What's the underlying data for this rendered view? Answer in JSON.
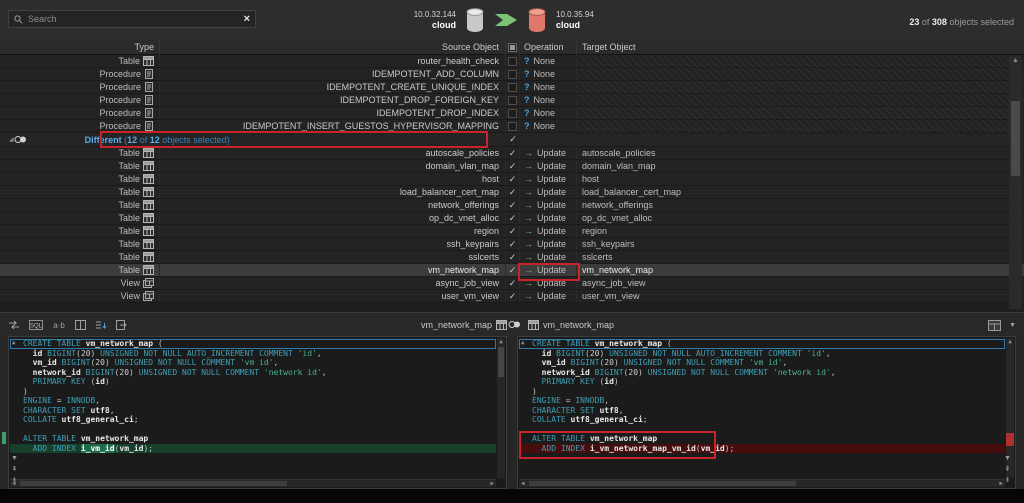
{
  "colors": {
    "annotation_red": "#c9242b",
    "update_green": "#6abf69",
    "none_question_blue": "#4f9fd8",
    "group_text_blue": "#4aa0dc",
    "source_db_icon": "#c9c9c9",
    "target_db_icon": "#e0776a",
    "transfer_arrow_green": "#7cc576",
    "diff_added_bg": "#16402c",
    "diff_removed_bg": "#470d0d",
    "sql_keyword": "#3f9fb5",
    "sql_string": "#4cb193"
  },
  "topbar": {
    "search_placeholder": "Search",
    "clear_glyph": "×",
    "source_connection": {
      "host": "10.0.32.144",
      "database": "cloud"
    },
    "target_connection": {
      "host": "10.0.35.94",
      "database": "cloud"
    },
    "selection": {
      "selected_count": "23",
      "of_word": "of",
      "total_count": "308",
      "suffix": "objects selected"
    }
  },
  "grid": {
    "columns": {
      "type": "Type",
      "source": "Source Object",
      "operation": "Operation",
      "target": "Target Object"
    },
    "only_source_rows": [
      {
        "type": "Table",
        "icon": "table",
        "source": "router_health_check",
        "checked": false,
        "operation": "None",
        "target": ""
      },
      {
        "type": "Procedure",
        "icon": "procedure",
        "source": "IDEMPOTENT_ADD_COLUMN",
        "checked": false,
        "operation": "None",
        "target": ""
      },
      {
        "type": "Procedure",
        "icon": "procedure",
        "source": "IDEMPOTENT_CREATE_UNIQUE_INDEX",
        "checked": false,
        "operation": "None",
        "target": ""
      },
      {
        "type": "Procedure",
        "icon": "procedure",
        "source": "IDEMPOTENT_DROP_FOREIGN_KEY",
        "checked": false,
        "operation": "None",
        "target": ""
      },
      {
        "type": "Procedure",
        "icon": "procedure",
        "source": "IDEMPOTENT_DROP_INDEX",
        "checked": false,
        "operation": "None",
        "target": ""
      },
      {
        "type": "Procedure",
        "icon": "procedure",
        "source": "IDEMPOTENT_INSERT_GUESTOS_HYPERVISOR_MAPPING",
        "checked": false,
        "operation": "None",
        "target": ""
      }
    ],
    "group": {
      "name": "Different",
      "open_paren": "(",
      "selected_count": "12",
      "of_word": "of",
      "total_count": "12",
      "suffix": "objects selected)"
    },
    "different_rows": [
      {
        "type": "Table",
        "icon": "table",
        "source": "autoscale_policies",
        "checked": true,
        "operation": "Update",
        "target": "autoscale_policies"
      },
      {
        "type": "Table",
        "icon": "table",
        "source": "domain_vlan_map",
        "checked": true,
        "operation": "Update",
        "target": "domain_vlan_map"
      },
      {
        "type": "Table",
        "icon": "table",
        "source": "host",
        "checked": true,
        "operation": "Update",
        "target": "host"
      },
      {
        "type": "Table",
        "icon": "table",
        "source": "load_balancer_cert_map",
        "checked": true,
        "operation": "Update",
        "target": "load_balancer_cert_map"
      },
      {
        "type": "Table",
        "icon": "table",
        "source": "network_offerings",
        "checked": true,
        "operation": "Update",
        "target": "network_offerings"
      },
      {
        "type": "Table",
        "icon": "table",
        "source": "op_dc_vnet_alloc",
        "checked": true,
        "operation": "Update",
        "target": "op_dc_vnet_alloc"
      },
      {
        "type": "Table",
        "icon": "table",
        "source": "region",
        "checked": true,
        "operation": "Update",
        "target": "region"
      },
      {
        "type": "Table",
        "icon": "table",
        "source": "ssh_keypairs",
        "checked": true,
        "operation": "Update",
        "target": "ssh_keypairs"
      },
      {
        "type": "Table",
        "icon": "table",
        "source": "sslcerts",
        "checked": true,
        "operation": "Update",
        "target": "sslcerts"
      },
      {
        "type": "Table",
        "icon": "table",
        "source": "vm_network_map",
        "checked": true,
        "operation": "Update",
        "target": "vm_network_map",
        "selected": true
      },
      {
        "type": "View",
        "icon": "view",
        "source": "async_job_view",
        "checked": true,
        "operation": "Update",
        "target": "async_job_view"
      },
      {
        "type": "View",
        "icon": "view",
        "source": "user_vm_view",
        "checked": true,
        "operation": "Update",
        "target": "user_vm_view"
      }
    ]
  },
  "editor": {
    "left_title": "vm_network_map",
    "right_title": "vm_network_map",
    "left_lines": [
      {
        "hl": "cur",
        "t": [
          [
            "k",
            "CREATE TABLE"
          ],
          [
            "p",
            " "
          ],
          [
            "i",
            "vm_network_map"
          ],
          [
            "p",
            " ("
          ]
        ]
      },
      {
        "t": [
          [
            "p",
            "  "
          ],
          [
            "i",
            "id"
          ],
          [
            "p",
            " "
          ],
          [
            "k",
            "BIGINT"
          ],
          [
            "p",
            "("
          ],
          [
            "n",
            "20"
          ],
          [
            "p",
            ") "
          ],
          [
            "k",
            "UNSIGNED NOT NULL AUTO_INCREMENT COMMENT"
          ],
          [
            "p",
            " "
          ],
          [
            "s",
            "'id'"
          ],
          [
            "p",
            ","
          ]
        ]
      },
      {
        "t": [
          [
            "p",
            "  "
          ],
          [
            "i",
            "vm_id"
          ],
          [
            "p",
            " "
          ],
          [
            "k",
            "BIGINT"
          ],
          [
            "p",
            "("
          ],
          [
            "n",
            "20"
          ],
          [
            "p",
            ") "
          ],
          [
            "k",
            "UNSIGNED NOT NULL COMMENT"
          ],
          [
            "p",
            " "
          ],
          [
            "s",
            "'vm id'"
          ],
          [
            "p",
            ","
          ]
        ]
      },
      {
        "t": [
          [
            "p",
            "  "
          ],
          [
            "i",
            "network_id"
          ],
          [
            "p",
            " "
          ],
          [
            "k",
            "BIGINT"
          ],
          [
            "p",
            "("
          ],
          [
            "n",
            "20"
          ],
          [
            "p",
            ") "
          ],
          [
            "k",
            "UNSIGNED NOT NULL COMMENT"
          ],
          [
            "p",
            " "
          ],
          [
            "s",
            "'network id'"
          ],
          [
            "p",
            ","
          ]
        ]
      },
      {
        "t": [
          [
            "p",
            "  "
          ],
          [
            "k",
            "PRIMARY KEY"
          ],
          [
            "p",
            " ("
          ],
          [
            "i",
            "id"
          ],
          [
            "p",
            ")"
          ]
        ]
      },
      {
        "t": [
          [
            "p",
            ")"
          ]
        ]
      },
      {
        "t": [
          [
            "k",
            "ENGINE"
          ],
          [
            "p",
            " = "
          ],
          [
            "k",
            "INNODB"
          ],
          [
            "p",
            ","
          ]
        ]
      },
      {
        "t": [
          [
            "k",
            "CHARACTER SET"
          ],
          [
            "p",
            " "
          ],
          [
            "i",
            "utf8"
          ],
          [
            "p",
            ","
          ]
        ]
      },
      {
        "t": [
          [
            "k",
            "COLLATE"
          ],
          [
            "p",
            " "
          ],
          [
            "i",
            "utf8_general_ci"
          ],
          [
            "p",
            ";"
          ]
        ]
      },
      {
        "t": []
      },
      {
        "t": [
          [
            "k",
            "ALTER TABLE"
          ],
          [
            "p",
            " "
          ],
          [
            "i",
            "vm_network_map"
          ]
        ]
      },
      {
        "hl": "green",
        "t": [
          [
            "p",
            "  "
          ],
          [
            "k",
            "ADD INDEX"
          ],
          [
            "p",
            " "
          ],
          [
            "hi",
            "i_vm_id"
          ],
          [
            "p",
            "("
          ],
          [
            "i",
            "vm_id"
          ],
          [
            "p",
            ");"
          ]
        ]
      }
    ],
    "right_lines": [
      {
        "hl": "cur",
        "t": [
          [
            "k",
            "CREATE TABLE"
          ],
          [
            "p",
            " "
          ],
          [
            "i",
            "vm_network_map"
          ],
          [
            "p",
            " ("
          ]
        ]
      },
      {
        "t": [
          [
            "p",
            "  "
          ],
          [
            "i",
            "id"
          ],
          [
            "p",
            " "
          ],
          [
            "k",
            "BIGINT"
          ],
          [
            "p",
            "("
          ],
          [
            "n",
            "20"
          ],
          [
            "p",
            ") "
          ],
          [
            "k",
            "UNSIGNED NOT NULL AUTO_INCREMENT COMMENT"
          ],
          [
            "p",
            " "
          ],
          [
            "s",
            "'id'"
          ],
          [
            "p",
            ","
          ]
        ]
      },
      {
        "t": [
          [
            "p",
            "  "
          ],
          [
            "i",
            "vm_id"
          ],
          [
            "p",
            " "
          ],
          [
            "k",
            "BIGINT"
          ],
          [
            "p",
            "("
          ],
          [
            "n",
            "20"
          ],
          [
            "p",
            ") "
          ],
          [
            "k",
            "UNSIGNED NOT NULL COMMENT"
          ],
          [
            "p",
            " "
          ],
          [
            "s",
            "'vm id'"
          ],
          [
            "p",
            ","
          ]
        ]
      },
      {
        "t": [
          [
            "p",
            "  "
          ],
          [
            "i",
            "network_id"
          ],
          [
            "p",
            " "
          ],
          [
            "k",
            "BIGINT"
          ],
          [
            "p",
            "("
          ],
          [
            "n",
            "20"
          ],
          [
            "p",
            ") "
          ],
          [
            "k",
            "UNSIGNED NOT NULL COMMENT"
          ],
          [
            "p",
            " "
          ],
          [
            "s",
            "'network id'"
          ],
          [
            "p",
            ","
          ]
        ]
      },
      {
        "t": [
          [
            "p",
            "  "
          ],
          [
            "k",
            "PRIMARY KEY"
          ],
          [
            "p",
            " ("
          ],
          [
            "i",
            "id"
          ],
          [
            "p",
            ")"
          ]
        ]
      },
      {
        "t": [
          [
            "p",
            ")"
          ]
        ]
      },
      {
        "t": [
          [
            "k",
            "ENGINE"
          ],
          [
            "p",
            " = "
          ],
          [
            "k",
            "INNODB"
          ],
          [
            "p",
            ","
          ]
        ]
      },
      {
        "t": [
          [
            "k",
            "CHARACTER SET"
          ],
          [
            "p",
            " "
          ],
          [
            "i",
            "utf8"
          ],
          [
            "p",
            ","
          ]
        ]
      },
      {
        "t": [
          [
            "k",
            "COLLATE"
          ],
          [
            "p",
            " "
          ],
          [
            "i",
            "utf8_general_ci"
          ],
          [
            "p",
            ";"
          ]
        ]
      },
      {
        "t": []
      },
      {
        "t": [
          [
            "k",
            "ALTER TABLE"
          ],
          [
            "p",
            " "
          ],
          [
            "i",
            "vm_network_map"
          ]
        ]
      },
      {
        "hl": "red",
        "t": [
          [
            "p",
            "  "
          ],
          [
            "k",
            "ADD INDEX"
          ],
          [
            "p",
            " "
          ],
          [
            "i",
            "i_vm_network_map_vm_id"
          ],
          [
            "p",
            "("
          ],
          [
            "i",
            "vm_id"
          ],
          [
            "p",
            ");"
          ]
        ]
      }
    ]
  },
  "toolbar_icons": [
    "script-changes",
    "sql-badge",
    "compare-text",
    "split-view",
    "sort",
    "export"
  ]
}
